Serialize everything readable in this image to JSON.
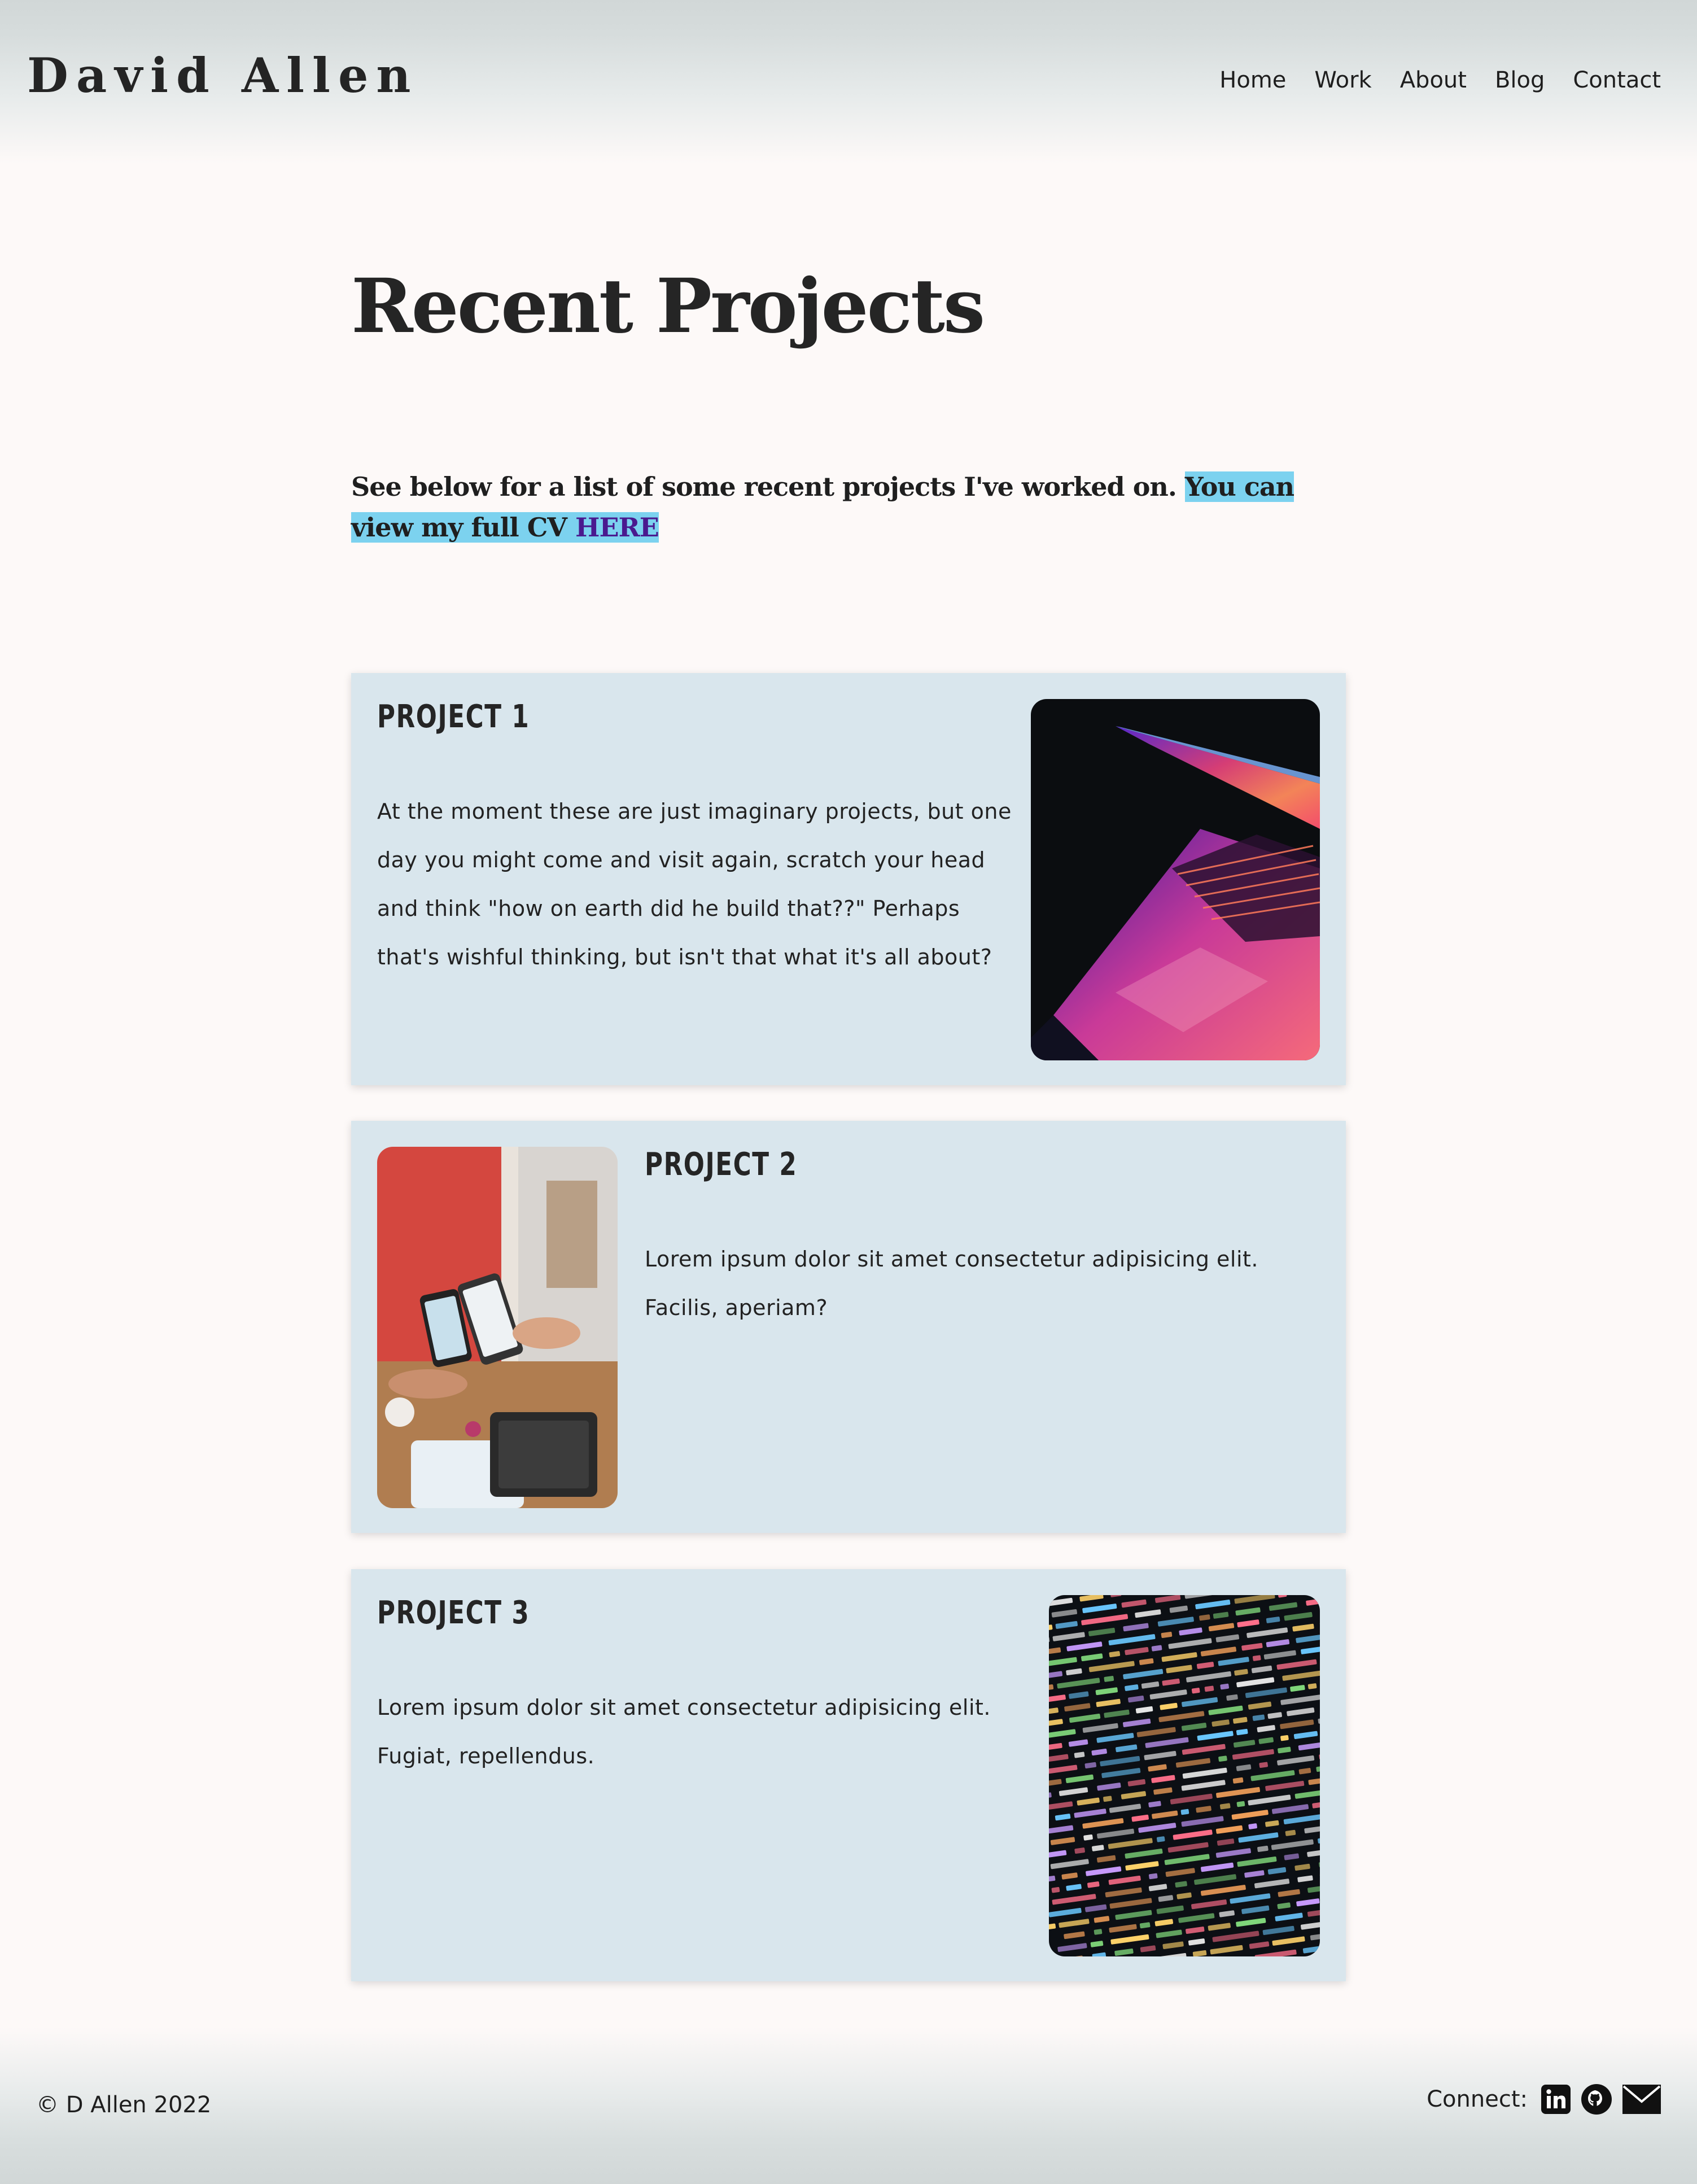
{
  "header": {
    "logo": "David Allen",
    "nav": [
      "Home",
      "Work",
      "About",
      "Blog",
      "Contact"
    ]
  },
  "main": {
    "title": "Recent Projects",
    "intro_text": "See below for a list of some recent projects I've worked on.",
    "intro_highlight": "You can view my full CV",
    "cv_link": "HERE"
  },
  "projects": [
    {
      "title": "PROJECT 1",
      "description": "At the moment these are just imaginary projects, but one day you might come and visit again, scratch your head and think \"how on earth did he build that??\" Perhaps that's wishful thinking, but isn't that what it's all about?",
      "image": "laptop-neon-photo",
      "image_side": "right"
    },
    {
      "title": "PROJECT 2",
      "description": "Lorem ipsum dolor sit amet consectetur adipisicing elit. Facilis, aperiam?",
      "image": "phones-payment-photo",
      "image_side": "left"
    },
    {
      "title": "PROJECT 3",
      "description": "Lorem ipsum dolor sit amet consectetur adipisicing elit. Fugiat, repellendus.",
      "image": "code-screen-photo",
      "image_side": "right"
    }
  ],
  "footer": {
    "copyright": "© D Allen 2022",
    "connect_label": "Connect:",
    "icons": [
      "linkedin-icon",
      "github-icon",
      "email-icon"
    ]
  },
  "colors": {
    "background": "#fdf9f8",
    "card": "#d9e6ed",
    "highlight": "#7cd2ef",
    "link": "#4a1a8f",
    "text": "#222222"
  }
}
